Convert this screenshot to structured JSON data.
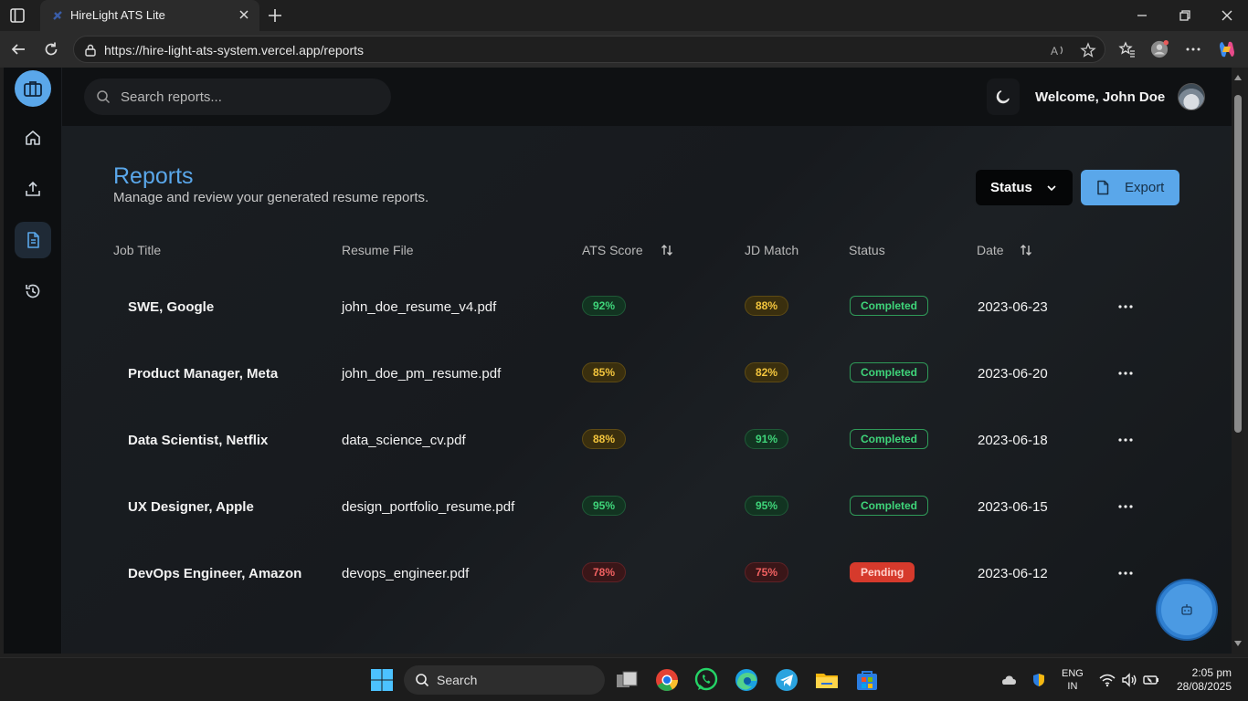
{
  "browser": {
    "tab_title": "HireLight ATS Lite",
    "url": "https://hire-light-ats-system.vercel.app/reports"
  },
  "topbar": {
    "search_placeholder": "Search reports...",
    "welcome": "Welcome, John Doe"
  },
  "page": {
    "title": "Reports",
    "subtitle": "Manage and review your generated resume reports.",
    "status_filter_label": "Status",
    "export_label": "Export"
  },
  "table": {
    "headers": {
      "job_title": "Job Title",
      "resume_file": "Resume File",
      "ats_score": "ATS Score",
      "jd_match": "JD Match",
      "status": "Status",
      "date": "Date"
    },
    "rows": [
      {
        "job": "SWE, Google",
        "file": "john_doe_resume_v4.pdf",
        "ats": "92%",
        "ats_level": "green",
        "jd": "88%",
        "jd_level": "yellow",
        "status": "Completed",
        "date": "2023-06-23"
      },
      {
        "job": "Product Manager, Meta",
        "file": "john_doe_pm_resume.pdf",
        "ats": "85%",
        "ats_level": "yellow",
        "jd": "82%",
        "jd_level": "yellow",
        "status": "Completed",
        "date": "2023-06-20"
      },
      {
        "job": "Data Scientist, Netflix",
        "file": "data_science_cv.pdf",
        "ats": "88%",
        "ats_level": "yellow",
        "jd": "91%",
        "jd_level": "green",
        "status": "Completed",
        "date": "2023-06-18"
      },
      {
        "job": "UX Designer, Apple",
        "file": "design_portfolio_resume.pdf",
        "ats": "95%",
        "ats_level": "green",
        "jd": "95%",
        "jd_level": "green",
        "status": "Completed",
        "date": "2023-06-15"
      },
      {
        "job": "DevOps Engineer, Amazon",
        "file": "devops_engineer.pdf",
        "ats": "78%",
        "ats_level": "red",
        "jd": "75%",
        "jd_level": "red",
        "status": "Pending",
        "date": "2023-06-12"
      }
    ]
  },
  "taskbar": {
    "search_label": "Search",
    "lang_top": "ENG",
    "lang_bottom": "IN",
    "time": "2:05 pm",
    "date": "28/08/2025"
  },
  "colors": {
    "accent": "#5aa7ea",
    "green": "#3fd57a",
    "yellow": "#f3c53d",
    "red": "#f06060",
    "pending": "#d63a2c"
  }
}
